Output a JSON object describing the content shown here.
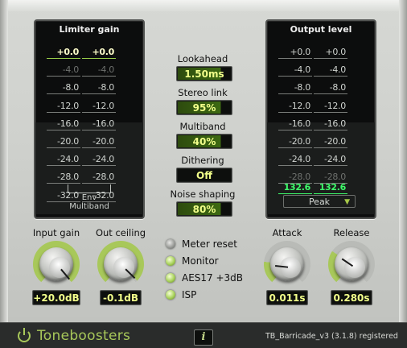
{
  "brand": {
    "name": "Toneboosters"
  },
  "status_text": "TB_Barricade_v3 (3.1.8) registered",
  "info_label": "i",
  "limiter_meter": {
    "title": "Limiter gain",
    "rows": [
      [
        "+0.0",
        "+0.0"
      ],
      [
        "-4.0",
        "-4.0"
      ],
      [
        "-8.0",
        "-8.0"
      ],
      [
        "-12.0",
        "-12.0"
      ],
      [
        "-16.0",
        "-16.0"
      ],
      [
        "-20.0",
        "-20.0"
      ],
      [
        "-24.0",
        "-24.0"
      ],
      [
        "-28.0",
        "-28.0"
      ],
      [
        "-32.0",
        "-32.0"
      ]
    ],
    "sub_labels": [
      "Env",
      "Multiband"
    ]
  },
  "output_meter": {
    "title": "Output level",
    "rows": [
      [
        "+0.0",
        "+0.0"
      ],
      [
        "-4.0",
        "-4.0"
      ],
      [
        "-8.0",
        "-8.0"
      ],
      [
        "-12.0",
        "-12.0"
      ],
      [
        "-16.0",
        "-16.0"
      ],
      [
        "-20.0",
        "-20.0"
      ],
      [
        "-24.0",
        "-24.0"
      ],
      [
        "-28.0",
        "-28.0"
      ]
    ],
    "readout": [
      "132.6",
      "132.6"
    ],
    "mode_value": "Peak"
  },
  "center_controls": [
    {
      "label": "Lookahead",
      "value": "1.50ms"
    },
    {
      "label": "Stereo link",
      "value": "95%"
    },
    {
      "label": "Multiband",
      "value": "40%"
    },
    {
      "label": "Dithering",
      "value": "Off"
    },
    {
      "label": "Noise shaping",
      "value": "80%"
    }
  ],
  "knobs": {
    "input_gain": {
      "label": "Input gain",
      "value": "+20.0dB",
      "level": 1.0
    },
    "out_ceiling": {
      "label": "Out ceiling",
      "value": "-0.1dB",
      "level": 0.98
    },
    "attack": {
      "label": "Attack",
      "value": "0.011s",
      "level": 0.2
    },
    "release": {
      "label": "Release",
      "value": "0.280s",
      "level": 0.3
    }
  },
  "toggles": [
    {
      "label": "Meter reset",
      "on": false
    },
    {
      "label": "Monitor",
      "on": true
    },
    {
      "label": "AES17 +3dB",
      "on": true
    },
    {
      "label": "ISP",
      "on": true
    }
  ],
  "colors": {
    "accent": "#a8c85a",
    "readout": "#f2ff8a",
    "meter_green": "#3dfc6a"
  }
}
